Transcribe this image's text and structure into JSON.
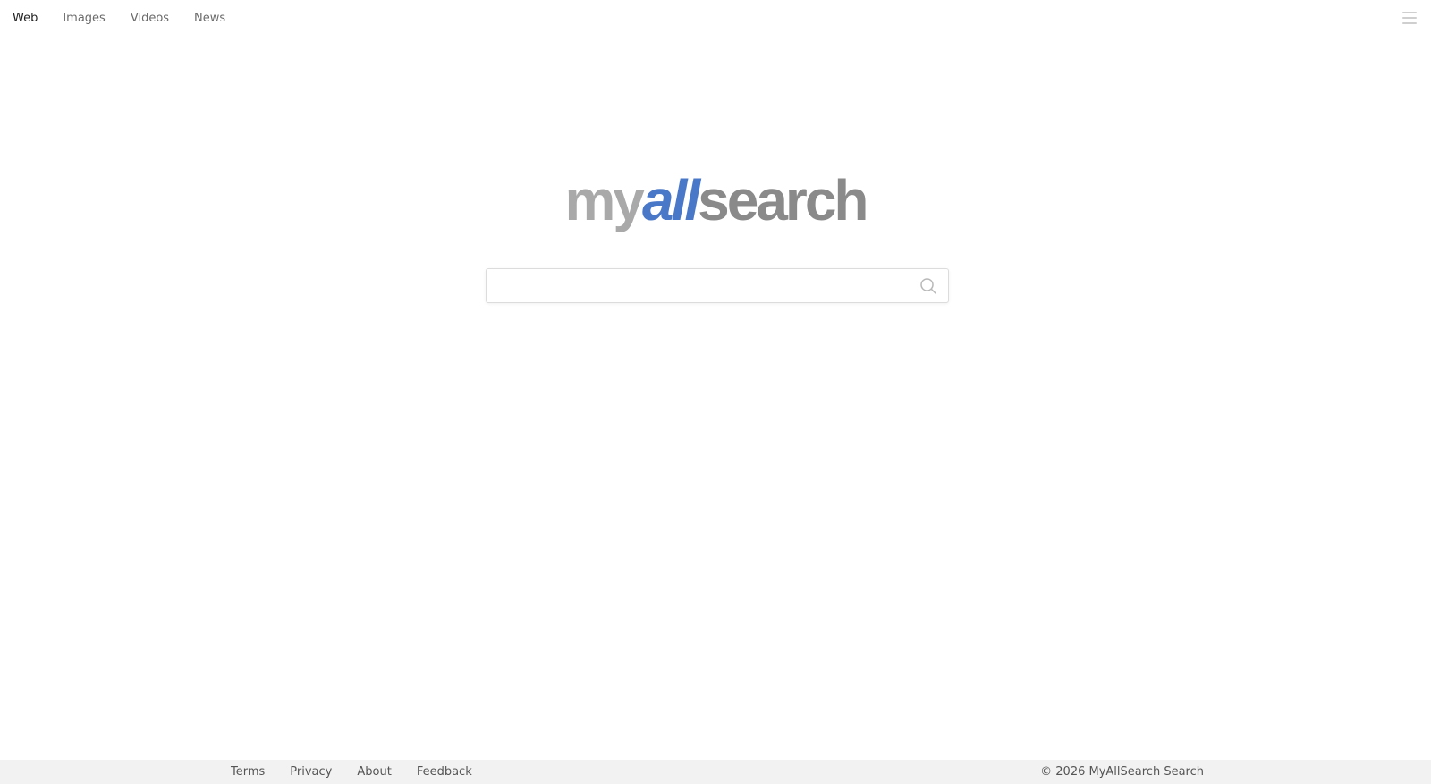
{
  "nav": {
    "items": [
      {
        "label": "Web",
        "active": true
      },
      {
        "label": "Images",
        "active": false
      },
      {
        "label": "Videos",
        "active": false
      },
      {
        "label": "News",
        "active": false
      }
    ],
    "menu_icon": "hamburger-menu-icon"
  },
  "logo": {
    "part1": "my",
    "part2": "all",
    "part3": "search",
    "colors": {
      "my": "#a9a9a9",
      "all": "#4a78c8",
      "search": "#8a8a8a"
    }
  },
  "search": {
    "value": "",
    "placeholder": "",
    "icon": "search-icon"
  },
  "footer": {
    "links": [
      "Terms",
      "Privacy",
      "About",
      "Feedback"
    ],
    "copyright": "© 2026 MyAllSearch Search"
  }
}
